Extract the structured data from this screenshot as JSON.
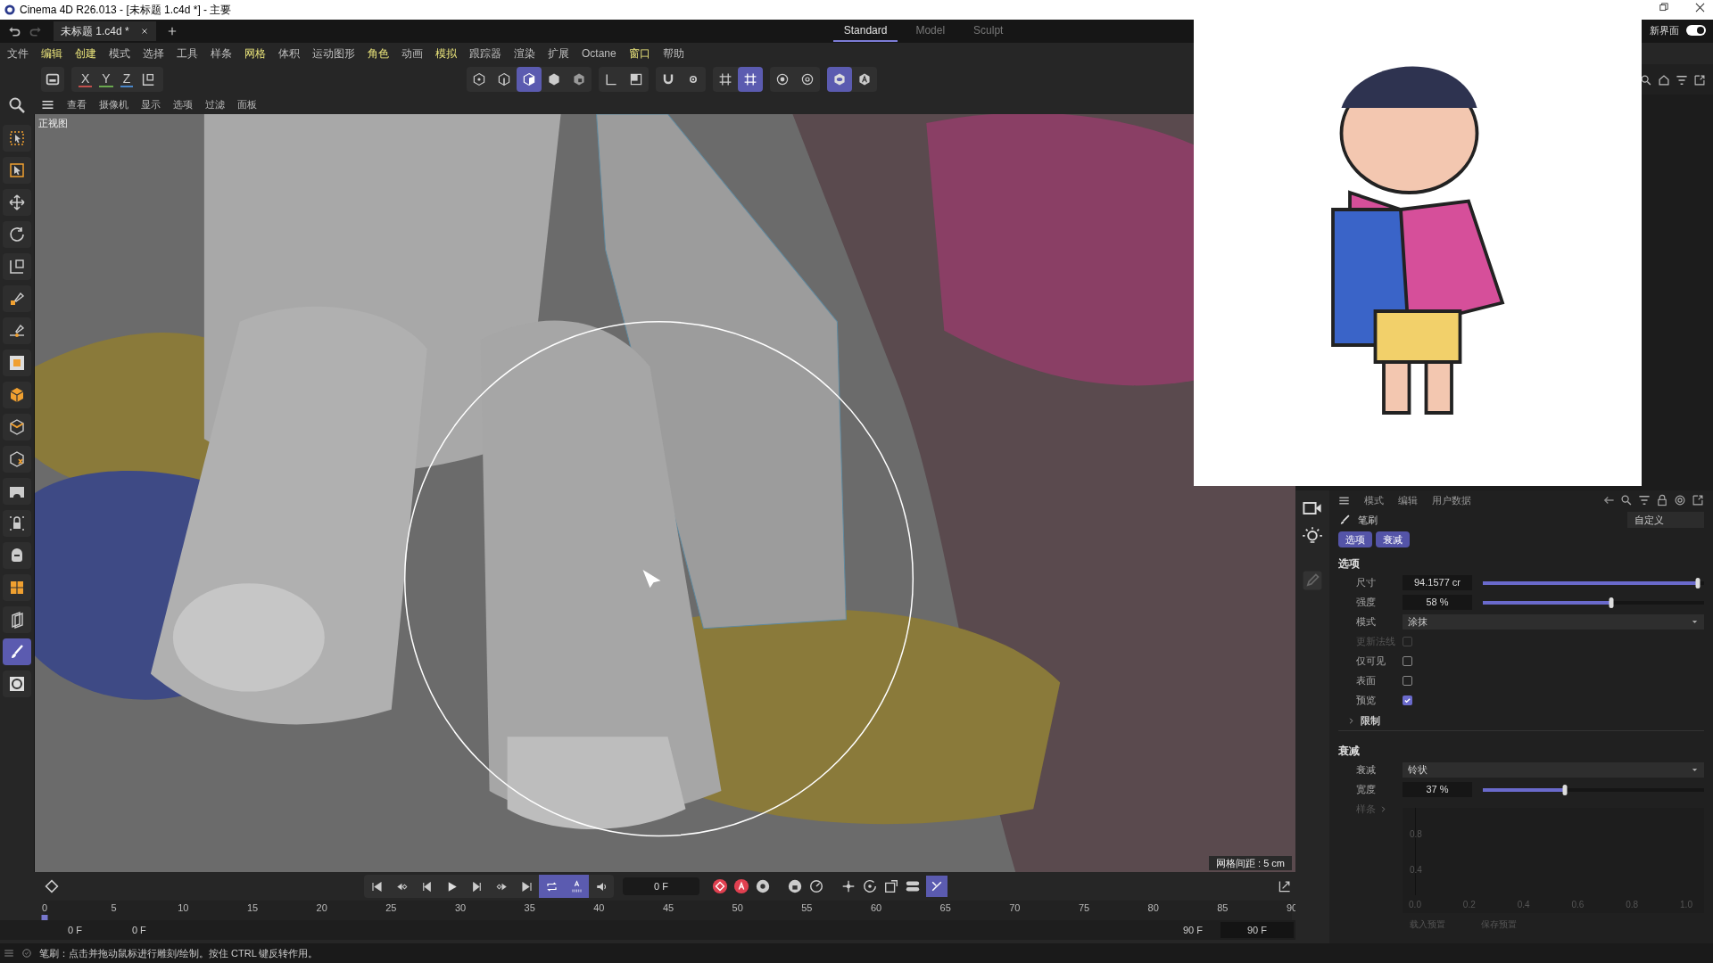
{
  "title_bar": {
    "title": "Cinema 4D R26.013 - [未标题 1.c4d *] - 主要"
  },
  "doc_tabs": [
    {
      "label": "未标题 1.c4d *",
      "selected": true
    }
  ],
  "layouts": [
    {
      "label": "Standard",
      "selected": true
    },
    {
      "label": "Model",
      "selected": false
    },
    {
      "label": "Sculpt",
      "selected": false
    }
  ],
  "new_ui": {
    "label": "新界面",
    "on": true
  },
  "menu": [
    {
      "label": "文件",
      "highlighted": false
    },
    {
      "label": "编辑",
      "highlighted": true
    },
    {
      "label": "创建",
      "highlighted": true
    },
    {
      "label": "模式",
      "highlighted": false
    },
    {
      "label": "选择",
      "highlighted": false
    },
    {
      "label": "工具",
      "highlighted": false
    },
    {
      "label": "样条",
      "highlighted": false
    },
    {
      "label": "网格",
      "highlighted": true
    },
    {
      "label": "体积",
      "highlighted": false
    },
    {
      "label": "运动图形",
      "highlighted": false
    },
    {
      "label": "角色",
      "highlighted": true
    },
    {
      "label": "动画",
      "highlighted": false
    },
    {
      "label": "模拟",
      "highlighted": true
    },
    {
      "label": "跟踪器",
      "highlighted": false
    },
    {
      "label": "渲染",
      "highlighted": false
    },
    {
      "label": "扩展",
      "highlighted": false
    },
    {
      "label": "Octane",
      "highlighted": false
    },
    {
      "label": "窗口",
      "highlighted": true
    },
    {
      "label": "帮助",
      "highlighted": false
    }
  ],
  "axis_buttons": [
    {
      "label": "X",
      "color": "#c0504d"
    },
    {
      "label": "Y",
      "color": "#6aa84f"
    },
    {
      "label": "Z",
      "color": "#4a86c8"
    }
  ],
  "mode_tools": [
    {
      "selected": false
    },
    {
      "selected": false
    },
    {
      "selected": true
    },
    {
      "selected": false
    },
    {
      "selected": false
    }
  ],
  "snap_tools": [
    {
      "selected": false
    },
    {
      "selected": true
    }
  ],
  "view_tools": [
    {
      "selected": true
    },
    {
      "selected": false
    }
  ],
  "viewport_menu": [
    "查看",
    "摄像机",
    "显示",
    "选项",
    "过滤",
    "面板"
  ],
  "viewport": {
    "view_label": "正视图",
    "grid_spacing": "网格间距 : 5 cm"
  },
  "left_tools": [
    {
      "selected": false
    },
    {
      "selected": false
    },
    {
      "selected": false
    },
    {
      "selected": false
    },
    {
      "selected": false
    },
    {
      "selected": false
    },
    {
      "selected": false
    },
    {
      "selected": false
    },
    {
      "selected": false
    },
    {
      "selected": false
    },
    {
      "selected": false
    },
    {
      "selected": false
    },
    {
      "selected": false
    },
    {
      "selected": false
    },
    {
      "selected": false
    },
    {
      "selected": false
    },
    {
      "selected": true
    },
    {
      "selected": false
    }
  ],
  "attributes": {
    "header_menu": [
      "模式",
      "编辑",
      "用户数据"
    ],
    "object": "笔刷",
    "preset": "自定义",
    "tabs": [
      {
        "label": "选项",
        "selected": true
      },
      {
        "label": "衰减",
        "selected": true
      }
    ],
    "sections": [
      {
        "title": "选项",
        "fields": [
          {
            "kind": "slider",
            "label": "尺寸",
            "value": "94.1577 cr",
            "level": 0.97
          },
          {
            "kind": "slider",
            "label": "强度",
            "value": "58 %",
            "level": 0.58
          },
          {
            "kind": "dropdown",
            "label": "模式",
            "value": "涂抹"
          },
          {
            "kind": "checkbox",
            "label": "更新法线",
            "checked": false,
            "disabled": true
          },
          {
            "kind": "checkbox",
            "label": "仅可见",
            "checked": false,
            "disabled": false
          },
          {
            "kind": "checkbox",
            "label": "表面",
            "checked": false,
            "disabled": false
          },
          {
            "kind": "checkbox",
            "label": "预览",
            "checked": true,
            "disabled": false
          },
          {
            "kind": "group",
            "label": "限制",
            "expanded": false
          }
        ]
      },
      {
        "title": "衰减",
        "fields": [
          {
            "kind": "dropdown",
            "label": "衰减",
            "value": "铃状"
          },
          {
            "kind": "slider",
            "label": "宽度",
            "value": "37 %",
            "level": 0.37
          },
          {
            "kind": "link",
            "label": "样条",
            "disabled": true
          }
        ]
      }
    ],
    "graph": {
      "y_labels": [
        "0.8",
        "0.4"
      ],
      "x_labels": [
        "0.0",
        "0.2",
        "0.4",
        "0.6",
        "0.8",
        "1.0"
      ]
    },
    "preset_buttons": [
      "载入预置",
      "保存预置"
    ]
  },
  "transport": [
    {
      "selected": false
    },
    {
      "selected": false
    },
    {
      "selected": false
    },
    {
      "selected": false
    },
    {
      "selected": false
    },
    {
      "selected": false
    },
    {
      "selected": false
    },
    {
      "selected": true
    },
    {
      "selected": true
    },
    {
      "selected": false
    }
  ],
  "timeline": {
    "current_frame": "0 F",
    "ticks": [
      "0",
      "5",
      "10",
      "15",
      "20",
      "25",
      "30",
      "35",
      "40",
      "45",
      "50",
      "55",
      "60",
      "65",
      "70",
      "75",
      "80",
      "85",
      "90"
    ],
    "start": "0 F",
    "preview_start": "0 F",
    "preview_end": "90 F",
    "end": "90 F"
  },
  "status_bar": {
    "text": "笔刷：点击并拖动鼠标进行雕刻/绘制。按住 CTRL 键反转作用。"
  }
}
